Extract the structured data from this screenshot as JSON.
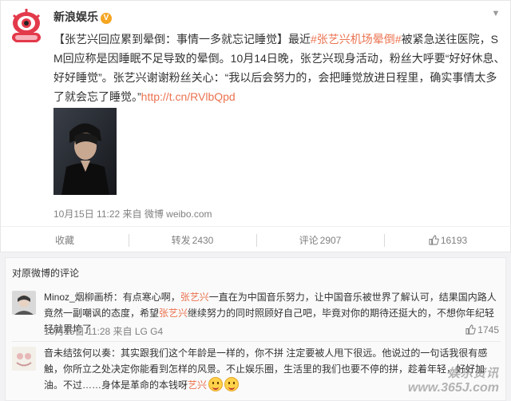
{
  "post": {
    "author": "新浪娱乐",
    "verified_badge": "V",
    "text_parts": {
      "title": "【张艺兴回应累到晕倒：事情一多就忘记睡觉】",
      "p1": "最近",
      "topic": "#张艺兴机场晕倒#",
      "p2": "被紧急送往医院，SM回应称是因睡眠不足导致的晕倒。10月14日晚，张艺兴现身活动，粉丝大呼要“好好休息、好好睡觉”。张艺兴谢谢粉丝关心：“我以后会努力的，会把睡觉放进日程里，确实事情太多了就会忘了睡觉。”",
      "link": "http://t.cn/RVlbQpd"
    },
    "meta": "10月15日 11:22 来自 微博 weibo.com"
  },
  "actions": {
    "favorite": "收藏",
    "repost_label": "转发",
    "repost_count": "2430",
    "comment_label": "评论",
    "comment_count": "2907",
    "like_count": "16193"
  },
  "comments_title": "对原微博的评论",
  "comments": [
    {
      "name": "Minoz_烟柳画桥",
      "sep": "：",
      "t1": "有点寒心啊，",
      "mention1": "张艺兴",
      "t2": "一直在为中国音乐努力，让中国音乐被世界了解认可，结果国内路人竟然一副嘲讽的态度，希望",
      "mention2": "张艺兴",
      "t3": "继续努力的同时照顾好自己吧，毕竟对你的期待还挺大的，不想你年纪轻轻就累垮了",
      "meta": "10月15日 11:28 来自 LG G4",
      "likes": "1745"
    },
    {
      "name": "音未结弦何以奏",
      "sep": "：",
      "t1": "其实跟我们这个年龄是一样的，你不拼 注定要被人甩下很远。他说过的一句话我很有感触，你所立之处决定你能看到怎样的风景。不止娱乐圈，生活里的我们也要不停的拼，趁着年轻，好好加油。不过……身体是革命的本钱呀",
      "mention1": "艺兴",
      "emoji_name": "smile-emoji"
    }
  ],
  "watermark": {
    "line1": "娱乐资讯",
    "line2": "www.365J.com"
  }
}
